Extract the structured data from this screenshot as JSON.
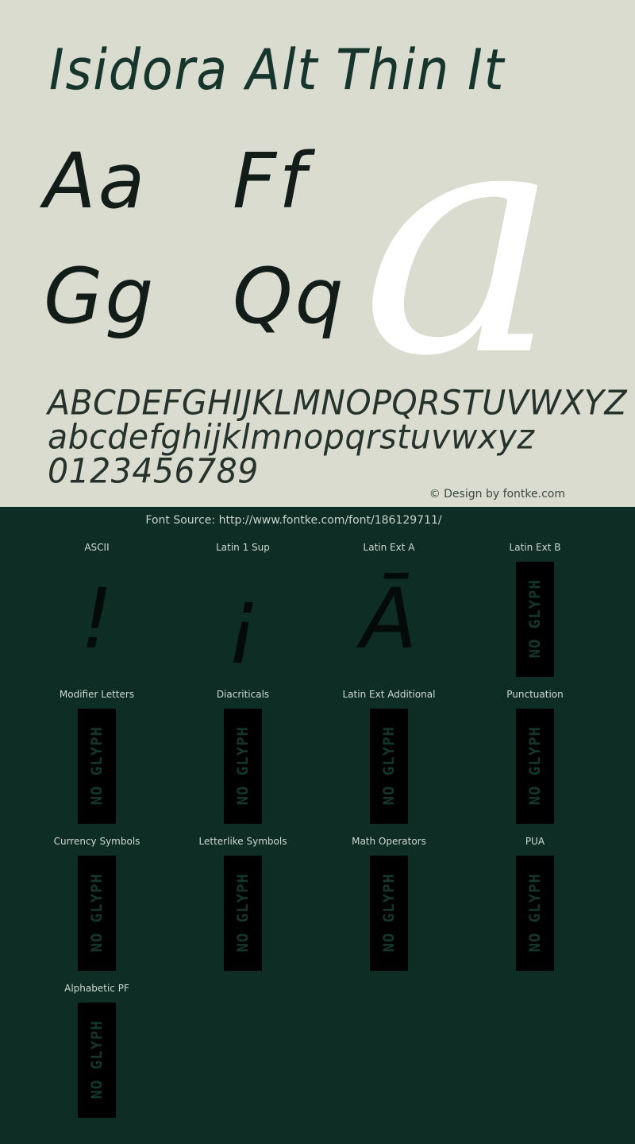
{
  "specimen": {
    "title": "Isidora Alt Thin It",
    "watermark_glyph": "a",
    "glyph_pairs": [
      {
        "left": "Aa",
        "right": "Ff"
      },
      {
        "left": "Gg",
        "right": "Qq"
      }
    ],
    "alphabet_lines": [
      "ABCDEFGHIJKLMNOPQRSTUVWXYZ",
      "abcdefghijklmnopqrstuvwxyz",
      "0123456789"
    ],
    "design_credit": "© Design by fontke.com"
  },
  "coverage": {
    "font_source": "Font Source: http://www.fontke.com/font/186129711/",
    "no_glyph_label": "NO GLYPH",
    "blocks": [
      {
        "label": "ASCII",
        "sample": "!",
        "has_glyph": true
      },
      {
        "label": "Latin 1 Sup",
        "sample": "¡",
        "has_glyph": true
      },
      {
        "label": "Latin Ext A",
        "sample": "Ā",
        "has_glyph": true
      },
      {
        "label": "Latin Ext B",
        "sample": "",
        "has_glyph": false
      },
      {
        "label": "Modifier Letters",
        "sample": "",
        "has_glyph": false
      },
      {
        "label": "Diacriticals",
        "sample": "",
        "has_glyph": false
      },
      {
        "label": "Latin Ext Additional",
        "sample": "",
        "has_glyph": false
      },
      {
        "label": "Punctuation",
        "sample": "",
        "has_glyph": false
      },
      {
        "label": "Currency Symbols",
        "sample": "",
        "has_glyph": false
      },
      {
        "label": "Letterlike Symbols",
        "sample": "",
        "has_glyph": false
      },
      {
        "label": "Math Operators",
        "sample": "",
        "has_glyph": false
      },
      {
        "label": "PUA",
        "sample": "",
        "has_glyph": false
      },
      {
        "label": "Alphabetic PF",
        "sample": "",
        "has_glyph": false
      }
    ]
  },
  "colors": {
    "specimen_background": "#d9dcce",
    "coverage_background": "#0e2e25",
    "title_text": "#16352c",
    "glyph_dark": "#121c18",
    "watermark": "#ffffff",
    "tofu_box": "#000000",
    "tofu_text": "#13372c"
  }
}
